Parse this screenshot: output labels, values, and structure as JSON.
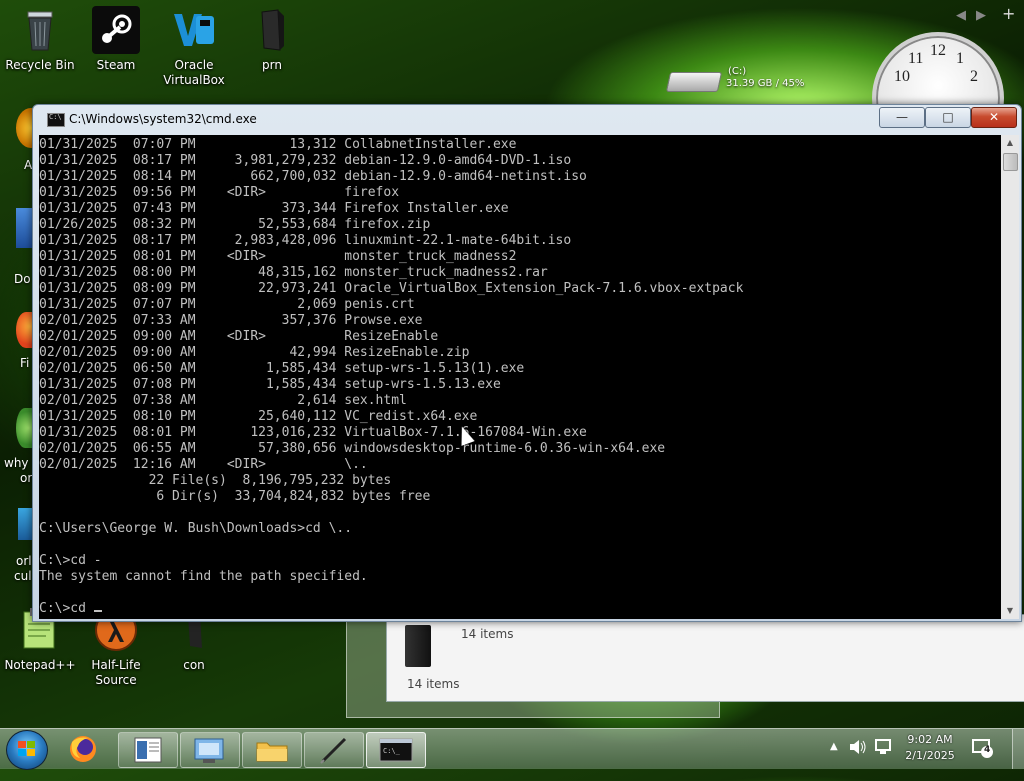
{
  "desktop": {
    "icons": [
      {
        "label": "Recycle Bin"
      },
      {
        "label": "Steam"
      },
      {
        "label": "Oracle VirtualBox"
      },
      {
        "label": "prn"
      },
      {
        "label": "Notepad++"
      },
      {
        "label": "Half-Life Source"
      },
      {
        "label": "con"
      }
    ],
    "partial_labels": [
      "A",
      "Do",
      "Fi",
      "why",
      "or",
      "orl",
      "cul"
    ],
    "drive_gadget": {
      "name": "(C:)",
      "info": "31.39 GB / 45%"
    },
    "clock_numbers": [
      "10",
      "11",
      "12",
      "1",
      "2"
    ]
  },
  "cmd_window": {
    "title": "C:\\Windows\\system32\\cmd.exe",
    "lines": [
      "01/31/2025  07:07 PM            13,312 CollabnetInstaller.exe",
      "01/31/2025  08:17 PM     3,981,279,232 debian-12.9.0-amd64-DVD-1.iso",
      "01/31/2025  08:14 PM       662,700,032 debian-12.9.0-amd64-netinst.iso",
      "01/31/2025  09:56 PM    <DIR>          firefox",
      "01/31/2025  07:43 PM           373,344 Firefox Installer.exe",
      "01/26/2025  08:32 PM        52,553,684 firefox.zip",
      "01/31/2025  08:17 PM     2,983,428,096 linuxmint-22.1-mate-64bit.iso",
      "01/31/2025  08:01 PM    <DIR>          monster_truck_madness2",
      "01/31/2025  08:00 PM        48,315,162 monster_truck_madness2.rar",
      "01/31/2025  08:09 PM        22,973,241 Oracle_VirtualBox_Extension_Pack-7.1.6.vbox-extpack",
      "01/31/2025  07:07 PM             2,069 penis.crt",
      "02/01/2025  07:33 AM           357,376 Prowse.exe",
      "02/01/2025  09:00 AM    <DIR>          ResizeEnable",
      "02/01/2025  09:00 AM            42,994 ResizeEnable.zip",
      "02/01/2025  06:50 AM         1,585,434 setup-wrs-1.5.13(1).exe",
      "01/31/2025  07:08 PM         1,585,434 setup-wrs-1.5.13.exe",
      "02/01/2025  07:38 AM             2,614 sex.html",
      "01/31/2025  08:10 PM        25,640,112 VC_redist.x64.exe",
      "01/31/2025  08:01 PM       123,016,232 VirtualBox-7.1.6-167084-Win.exe",
      "02/01/2025  06:55 AM        57,380,656 windowsdesktop-runtime-6.0.36-win-x64.exe",
      "02/01/2025  12:16 AM    <DIR>          \\..",
      "              22 File(s)  8,196,795,232 bytes",
      "               6 Dir(s)  33,704,824,832 bytes free",
      "",
      "C:\\Users\\George W. Bush\\Downloads>cd \\..",
      "",
      "C:\\>cd -",
      "The system cannot find the path specified.",
      "",
      "C:\\>cd "
    ]
  },
  "explorer": {
    "items_count_1": "14 items",
    "items_count_2": "14 items"
  },
  "taskbar": {
    "time": "9:02 AM",
    "date": "2/1/2025",
    "notification_count": "4",
    "apps": [
      "firefox",
      "explorer-window",
      "virtualbox",
      "file-explorer",
      "notepad",
      "cmd"
    ]
  }
}
